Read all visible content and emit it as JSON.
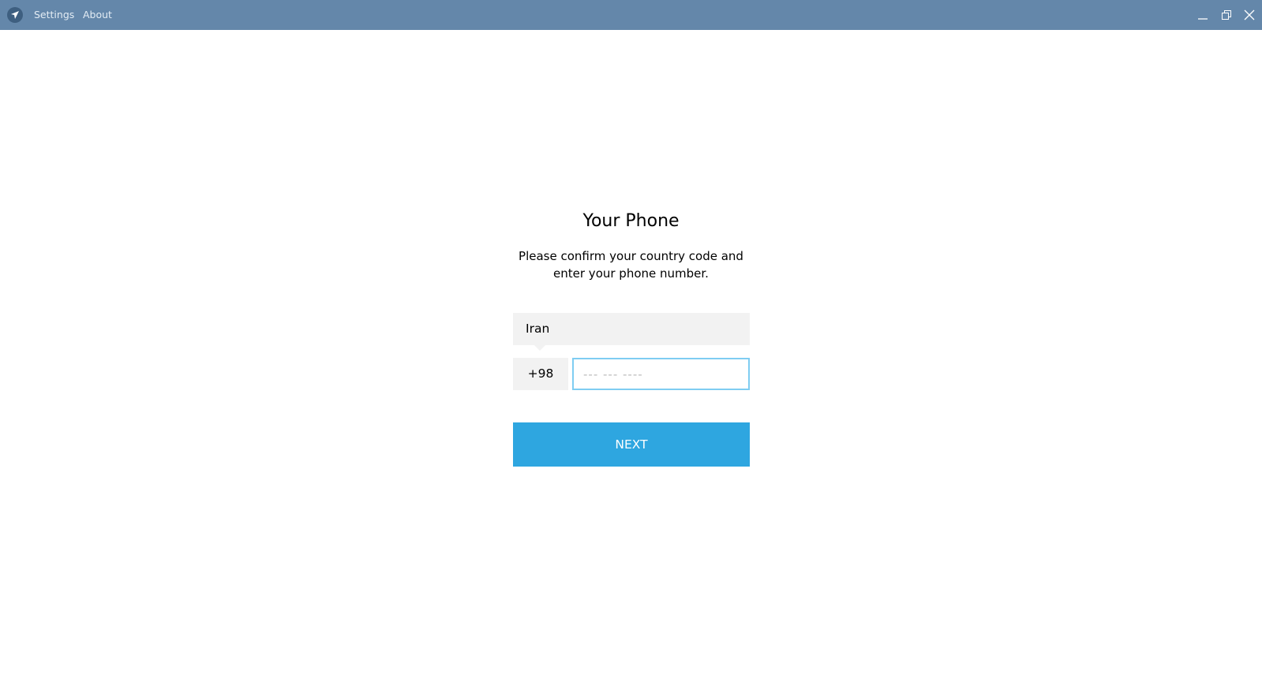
{
  "titlebar": {
    "menu": [
      "Settings",
      "About"
    ],
    "icons": [
      "telegram-logo-icon",
      "minimize-icon",
      "restore-icon",
      "close-icon"
    ],
    "color": "#6487aa"
  },
  "login": {
    "title": "Your Phone",
    "description_line1": "Please confirm your country code and",
    "description_line2": "enter your phone number.",
    "country": "Iran",
    "country_code": "+98",
    "phone_value": "",
    "phone_placeholder": "--- --- ----",
    "next_label": "NEXT",
    "accent": "#2ea6e0"
  }
}
